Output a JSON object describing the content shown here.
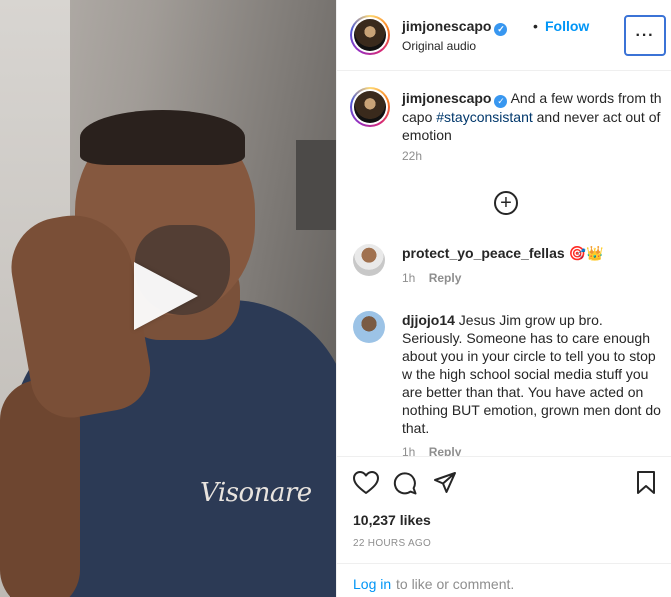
{
  "post": {
    "username": "jimjonescapo",
    "audio": "Original audio",
    "follow_label": "Follow",
    "more_label": "···",
    "separator": "•"
  },
  "caption": {
    "username": "jimjonescapo",
    "text_before": "And a few words from th capo",
    "hashtag": "#stayconsistant",
    "text_after": "and never act out of emotion",
    "time": "22h"
  },
  "load_more_label": "+",
  "comments": [
    {
      "username": "protect_yo_peace_fellas",
      "text": "🎯👑",
      "time": "1h",
      "reply_label": "Reply"
    },
    {
      "username": "djjojo14",
      "text": "Jesus Jim grow up bro. Seriously. Someone has to care enough about you in your circle to tell you to stop w the high school social media stuff you are better than that. You have acted on nothing BUT emotion, grown men dont do that.",
      "time": "1h",
      "reply_label": "Reply"
    }
  ],
  "media": {
    "shirt_text": "Visonare"
  },
  "stats": {
    "likes": "10,237 likes",
    "time": "22 HOURS AGO"
  },
  "login": {
    "link": "Log in",
    "rest": "to like or comment."
  },
  "icons": [
    "heart-icon",
    "comment-icon",
    "share-icon",
    "bookmark-icon",
    "verified-icon",
    "play-icon",
    "add-circle-icon"
  ],
  "colors": {
    "accent": "#0095f6",
    "verified": "#3897f0",
    "hashtag": "#00376b",
    "muted": "#8e8e8e"
  }
}
